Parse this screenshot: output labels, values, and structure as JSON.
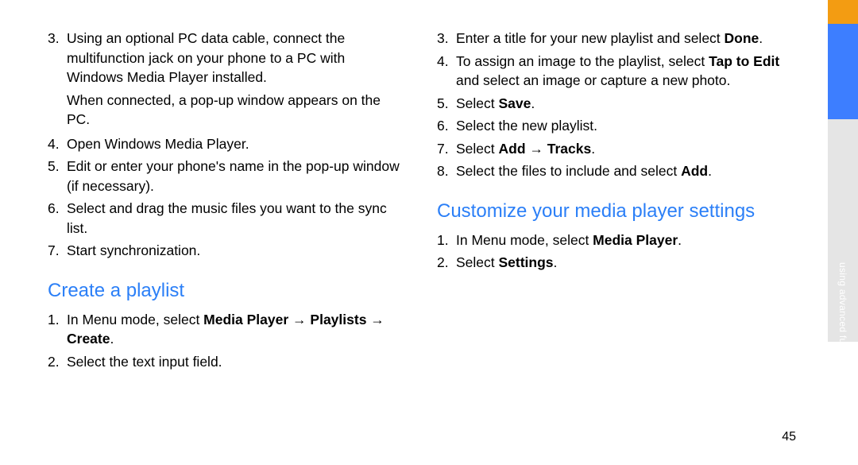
{
  "left_column": {
    "list1": [
      {
        "num": "3.",
        "segments": [
          {
            "t": "Using an optional PC data cable, connect the multifunction jack on your phone to a PC with Windows Media Player installed."
          }
        ]
      }
    ],
    "para1": "When connected, a pop-up window appears on the PC.",
    "list2": [
      {
        "num": "4.",
        "segments": [
          {
            "t": "Open Windows Media Player."
          }
        ]
      },
      {
        "num": "5.",
        "segments": [
          {
            "t": "Edit or enter your phone's name in the pop-up window (if necessary)."
          }
        ]
      },
      {
        "num": "6.",
        "segments": [
          {
            "t": "Select and drag the music files you want to the sync list."
          }
        ]
      },
      {
        "num": "7.",
        "segments": [
          {
            "t": "Start synchronization."
          }
        ]
      }
    ],
    "heading1": "Create a playlist",
    "list3": [
      {
        "num": "1.",
        "segments": [
          {
            "t": "In Menu mode, select "
          },
          {
            "t": "Media Player",
            "b": true
          },
          {
            "t": " → "
          },
          {
            "t": "Playlists",
            "b": true
          },
          {
            "t": " → "
          },
          {
            "t": "Create",
            "b": true
          },
          {
            "t": "."
          }
        ]
      },
      {
        "num": "2.",
        "segments": [
          {
            "t": "Select the text input field."
          }
        ]
      }
    ]
  },
  "right_column": {
    "list1": [
      {
        "num": "3.",
        "segments": [
          {
            "t": "Enter a title for your new playlist and select "
          },
          {
            "t": "Done",
            "b": true
          },
          {
            "t": "."
          }
        ]
      },
      {
        "num": "4.",
        "segments": [
          {
            "t": "To assign an image to the playlist, select "
          },
          {
            "t": "Tap to Edit",
            "b": true
          },
          {
            "t": " and select an image or capture a new photo."
          }
        ]
      },
      {
        "num": "5.",
        "segments": [
          {
            "t": "Select "
          },
          {
            "t": "Save",
            "b": true
          },
          {
            "t": "."
          }
        ]
      },
      {
        "num": "6.",
        "segments": [
          {
            "t": "Select the new playlist."
          }
        ]
      },
      {
        "num": "7.",
        "segments": [
          {
            "t": "Select "
          },
          {
            "t": "Add",
            "b": true
          },
          {
            "t": " → "
          },
          {
            "t": "Tracks",
            "b": true
          },
          {
            "t": "."
          }
        ]
      },
      {
        "num": "8.",
        "segments": [
          {
            "t": "Select the files to include and select "
          },
          {
            "t": "Add",
            "b": true
          },
          {
            "t": "."
          }
        ]
      }
    ],
    "heading1": "Customize your media player settings",
    "list2": [
      {
        "num": "1.",
        "segments": [
          {
            "t": "In Menu mode, select "
          },
          {
            "t": "Media Player",
            "b": true
          },
          {
            "t": "."
          }
        ]
      },
      {
        "num": "2.",
        "segments": [
          {
            "t": "Select "
          },
          {
            "t": "Settings",
            "b": true
          },
          {
            "t": "."
          }
        ]
      }
    ]
  },
  "side_tab_label": "using advanced functions",
  "page_number": "45"
}
